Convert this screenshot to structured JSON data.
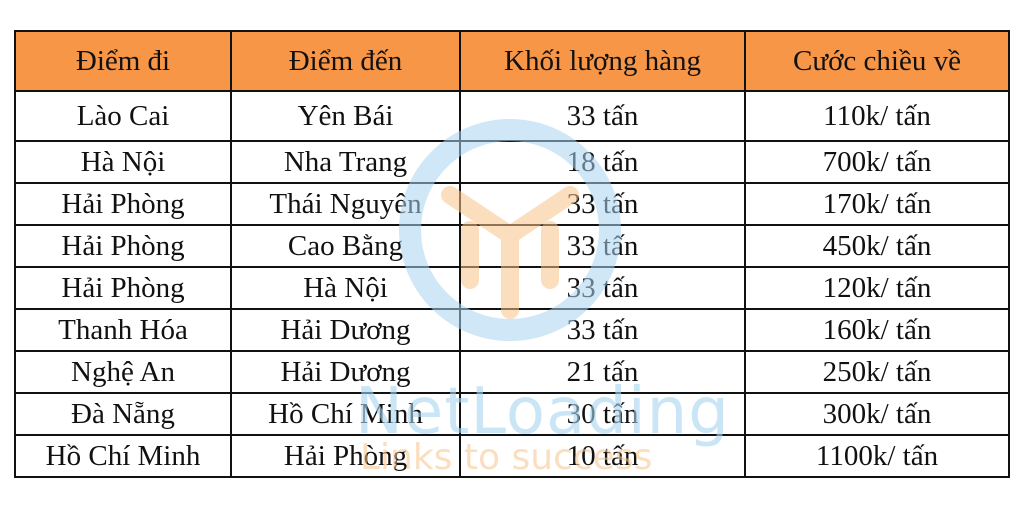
{
  "table": {
    "headers": [
      "Điểm đi",
      "Điểm đến",
      "Khối lượng hàng",
      "Cước chiều về"
    ],
    "rows": [
      [
        "Lào Cai",
        "Yên Bái",
        "33 tấn",
        "110k/ tấn"
      ],
      [
        "Hà Nội",
        "Nha Trang",
        "18 tấn",
        "700k/ tấn"
      ],
      [
        "Hải Phòng",
        "Thái Nguyên",
        "33 tấn",
        "170k/ tấn"
      ],
      [
        "Hải Phòng",
        "Cao Bằng",
        "33 tấn",
        "450k/ tấn"
      ],
      [
        "Hải Phòng",
        "Hà Nội",
        "33 tấn",
        "120k/ tấn"
      ],
      [
        "Thanh Hóa",
        "Hải Dương",
        "33 tấn",
        "160k/ tấn"
      ],
      [
        "Nghệ An",
        "Hải Dương",
        "21 tấn",
        "250k/ tấn"
      ],
      [
        "Đà Nẵng",
        "Hồ Chí Minh",
        "30 tấn",
        "300k/ tấn"
      ],
      [
        "Hồ Chí Minh",
        "Hải Phòng",
        "10 tấn",
        "1100k/ tấn"
      ]
    ],
    "header_color": "#f79646"
  },
  "watermark": {
    "brand": "NetLoading",
    "tagline": "Links to success",
    "colors": {
      "blue": "#a8d4ef",
      "orange": "#f9c48a"
    }
  }
}
